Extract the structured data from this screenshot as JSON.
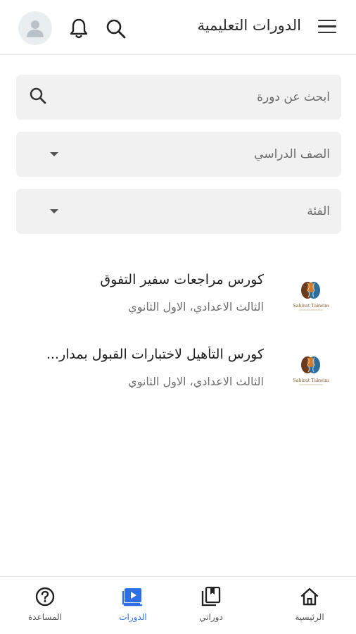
{
  "header": {
    "title": "الدورات التعليمية",
    "menu_icon": "hamburger-menu-icon",
    "search_icon": "search-icon",
    "bell_icon": "bell-icon",
    "avatar_icon": "user-avatar-icon"
  },
  "filters": {
    "search_placeholder": "ابحث عن دورة",
    "grade_label": "الصف الدراسي",
    "category_label": "الفئة"
  },
  "courses": [
    {
      "title": "كورس مراجعات سفير التفوق",
      "grades": "الثالث الاعدادي، الاول الثانوي"
    },
    {
      "title": "كورس التأهيل لاختبارات القبول بمدار...",
      "grades": "الثالث الاعدادي، الاول الثانوي"
    }
  ],
  "logo": {
    "text": "Sahirat Takwim",
    "colors": [
      "#6b3a1f",
      "#d07a2a",
      "#2d6d9a"
    ]
  },
  "bottom_nav": {
    "items": [
      {
        "label": "الرئيسية",
        "icon": "home-icon"
      },
      {
        "label": "دوراتي",
        "icon": "library-icon"
      },
      {
        "label": "الدورات",
        "icon": "play-courses-icon"
      },
      {
        "label": "المساعدة",
        "icon": "help-icon"
      }
    ],
    "active_index": 2,
    "active_color": "#2f6fe6"
  }
}
